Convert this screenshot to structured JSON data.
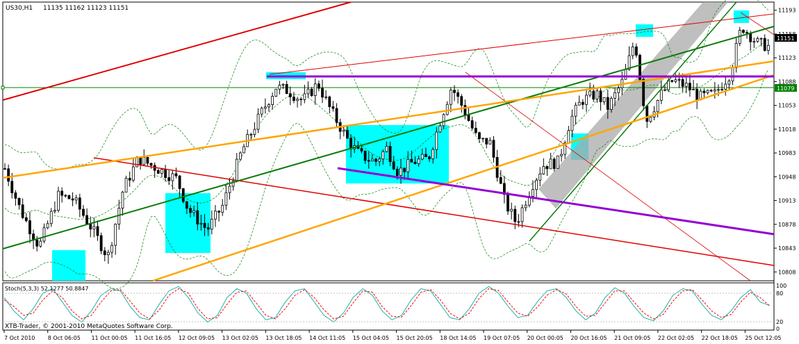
{
  "header": {
    "symbol": "US30,H1",
    "ohlc": "11135 11162 11123 11151"
  },
  "indicator": {
    "label": "Stoch(5,3,3) 52.1277 50.8847",
    "levels": [
      "100",
      "80",
      "20",
      "0"
    ]
  },
  "watermark": "XTB-Trader, © 2001-2010 MetaQuotes Software Corp.",
  "price_tags": {
    "current": "11151",
    "line": "11079"
  },
  "colors": {
    "background": "#ffffff",
    "candle": "#000000",
    "bollinger": "#008000",
    "resistance_red": "#e00000",
    "green_trend": "#0a7a0a",
    "orange_trend": "#ffa500",
    "purple": "#9400d3",
    "cyan_zone": "#00ffff",
    "gray_channel": "#a9a9a9",
    "stoch_main": "#20b2aa",
    "stoch_signal": "#ff0000"
  },
  "chart_data": {
    "type": "candlestick",
    "symbol": "US30",
    "timeframe": "H1",
    "ylim": [
      10795,
      11205
    ],
    "y_ticks": [
      "11193",
      "11158",
      "11123",
      "11088",
      "11053",
      "11018",
      "10983",
      "10948",
      "10913",
      "10878",
      "10843",
      "10808"
    ],
    "x_ticks": [
      "7 Oct 2010",
      "8 Oct 06:05",
      "11 Oct 00:05",
      "11 Oct 16:05",
      "12 Oct 09:05",
      "13 Oct 02:05",
      "13 Oct 18:05",
      "14 Oct 11:05",
      "15 Oct 04:05",
      "15 Oct 20:05",
      "18 Oct 14:05",
      "19 Oct 07:05",
      "20 Oct 00:05",
      "20 Oct 16:05",
      "21 Oct 09:05",
      "22 Oct 02:05",
      "22 Oct 18:05",
      "25 Oct 12:05"
    ],
    "price_path": [
      [
        0,
        10960
      ],
      [
        4,
        10900
      ],
      [
        9,
        10845
      ],
      [
        14,
        10920
      ],
      [
        18,
        10915
      ],
      [
        23,
        10870
      ],
      [
        27,
        10830
      ],
      [
        31,
        10930
      ],
      [
        35,
        10975
      ],
      [
        40,
        10960
      ],
      [
        45,
        10945
      ],
      [
        48,
        10900
      ],
      [
        53,
        10870
      ],
      [
        57,
        10905
      ],
      [
        62,
        10985
      ],
      [
        67,
        11040
      ],
      [
        71,
        11080
      ],
      [
        74,
        11075
      ],
      [
        78,
        11060
      ],
      [
        82,
        11085
      ],
      [
        85,
        11050
      ],
      [
        90,
        11000
      ],
      [
        93,
        10980
      ],
      [
        97,
        10970
      ],
      [
        100,
        10990
      ],
      [
        103,
        10955
      ],
      [
        107,
        10970
      ],
      [
        111,
        10975
      ],
      [
        114,
        11030
      ],
      [
        117,
        11080
      ],
      [
        120,
        11050
      ],
      [
        124,
        11000
      ],
      [
        127,
        11000
      ],
      [
        131,
        10910
      ],
      [
        134,
        10880
      ],
      [
        138,
        10935
      ],
      [
        141,
        10965
      ],
      [
        145,
        10970
      ],
      [
        148,
        11030
      ],
      [
        151,
        11060
      ],
      [
        155,
        11070
      ],
      [
        158,
        11050
      ],
      [
        162,
        11090
      ],
      [
        165,
        11150
      ],
      [
        168,
        11030
      ],
      [
        172,
        11070
      ],
      [
        175,
        11090
      ],
      [
        179,
        11080
      ],
      [
        182,
        11065
      ],
      [
        186,
        11070
      ],
      [
        190,
        11100
      ],
      [
        193,
        11170
      ],
      [
        197,
        11145
      ],
      [
        200,
        11140
      ]
    ],
    "stoch_main": [
      70,
      40,
      20,
      45,
      80,
      90,
      60,
      30,
      15,
      40,
      75,
      90,
      85,
      50,
      25,
      20,
      55,
      85,
      95,
      70,
      35,
      15,
      30,
      70,
      90,
      80,
      45,
      20,
      25,
      60,
      85,
      90,
      60,
      30,
      15,
      35,
      70,
      90,
      75,
      40,
      20,
      30,
      65,
      90,
      85,
      55,
      25,
      20,
      45,
      80,
      95,
      80,
      50,
      25,
      30,
      60,
      85,
      90,
      70,
      40,
      20,
      35,
      70,
      92,
      80,
      50,
      25,
      18,
      40,
      75,
      90,
      85,
      55,
      30,
      20,
      40,
      70,
      88,
      60,
      52
    ],
    "stoch_signal": [
      65,
      50,
      30,
      35,
      65,
      85,
      70,
      40,
      22,
      30,
      60,
      85,
      88,
      62,
      35,
      22,
      42,
      75,
      90,
      80,
      45,
      22,
      25,
      55,
      82,
      85,
      58,
      30,
      22,
      45,
      75,
      88,
      70,
      42,
      22,
      28,
      58,
      85,
      82,
      50,
      28,
      26,
      52,
      82,
      88,
      65,
      35,
      22,
      35,
      68,
      90,
      86,
      60,
      35,
      28,
      48,
      75,
      88,
      78,
      50,
      28,
      30,
      58,
      85,
      85,
      60,
      35,
      22,
      32,
      62,
      85,
      88,
      65,
      40,
      25,
      32,
      60,
      82,
      70,
      51
    ]
  }
}
